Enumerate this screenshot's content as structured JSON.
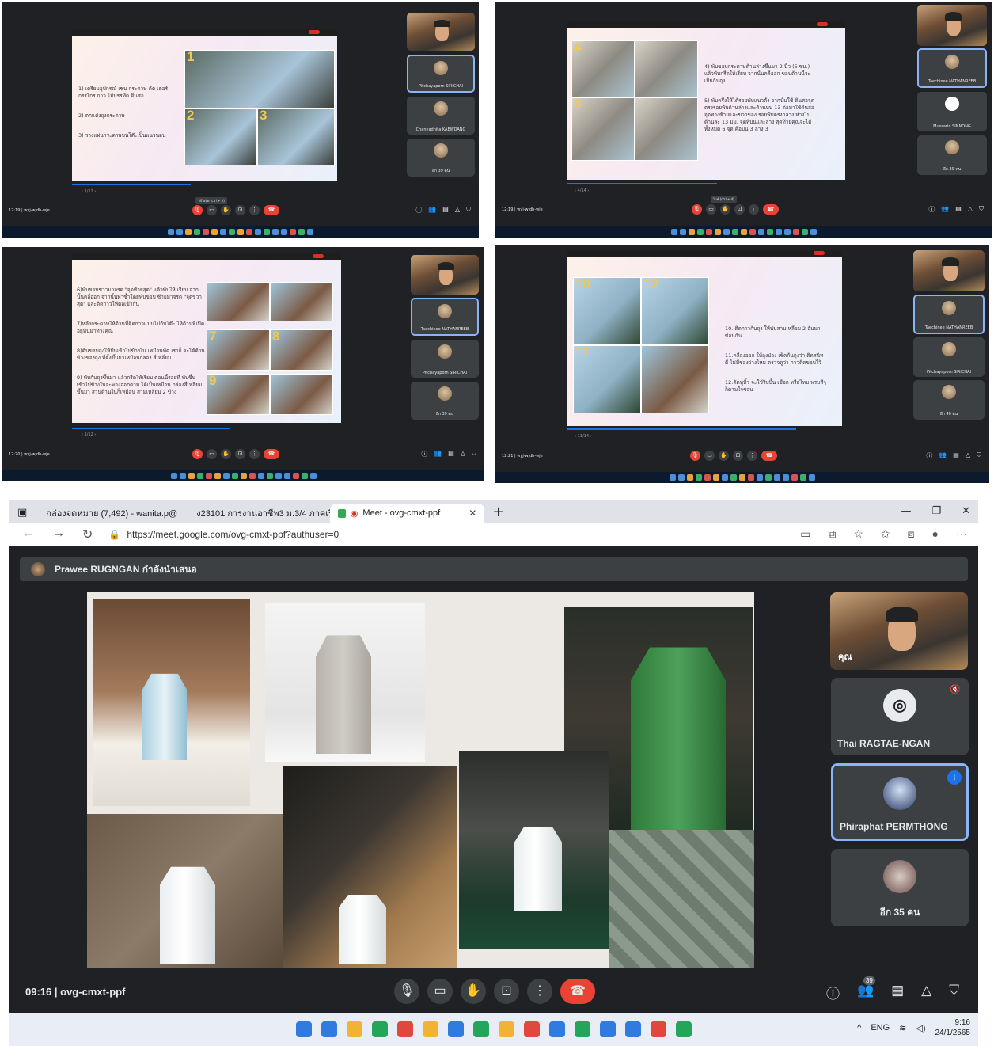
{
  "panel1": {
    "slide_lines": [
      "1) เตรียมอุปกรณ์ เช่น กระดาษ คัด เตอร์ กรรไกร กาว ไม้บรรทัด ดินสอ",
      "2) ตกแต่งถุงกระดาษ",
      "3) วางแผ่นกระดาษบนโต๊ะเป็นแนวนอน"
    ],
    "photo_numbers": [
      "1",
      "2",
      "3"
    ],
    "pager": "‹ 1/12 ›",
    "tooltip": "วิดีโอปิด (ctrl + e)",
    "tiles": [
      "Pitchayaporn SIRICHAI",
      "Chanyadhita KAEWDANG",
      "อีก 39 คน"
    ],
    "self_label": "คุณ",
    "clock": "12:19  |  wyj-wjdh-wje"
  },
  "panel2": {
    "slide_lines": [
      "4) พับขอบกระดาษด้านล่างขึ้นมา 2 นิ้ว (5 ซม.) แล้วพับกรีดให้เรียบ จากนั้นคลี่ออก ขอบด้านนี้จะเป็นก้นถุง",
      "5) พับครึ่งให้ได้รอยพับแนวตั้ง จากนั้นใช้ ดินสอจุดตรงรอยพับด้านล่างและด้านบน 13 ต่อมาใช้ดินสอจุดทางซ้ายและขวาของ รอยพับตรงกลาง ห่างไปด้านละ 13 มม. จุดที่บนและล่าง สุดท้ายคุณจะได้ทั้งหมด 6 จุด คือบน 3 ล่าง 3"
    ],
    "photo_numbers": [
      "4",
      "5"
    ],
    "pager": "‹ 4/14 ›",
    "tooltip": "ไมค์ (ctrl + d)",
    "tiles": [
      "Taechinee NATHANREEB",
      "Mussarin SINNONG",
      "อีก 39 คน"
    ],
    "self_label": "คุณ",
    "clock": "12:19  |  wyj-wjdh-wje"
  },
  "panel3": {
    "slide_lines": [
      "6)พับขอบขวามาจรด \"จุดซ้ายสุด\" แล้วพับให้ เรียบ จากนั้นคลี่ออก จากนั้นทำซ้ำโดยพับขอบ ซ้ายมาจรด \"จุดขวาสุด\" และติดกาวให้ต่อเข้ากัน",
      "7)หลังกระดาษให้ด้านที่ติดกาวแนบไปกับโต๊ะ ให้ด้านที่เปิดอยู่หันมาทางคุณ",
      "8)ดันขอบถุงให้ปันเข้าไปข้างใน เหมือนพัด เราก็ จะได้ด้านข้างของถุง ที่ตั้งขึ้นมาเหมือนกล่อง สี่เหลี่ยม",
      "9) พับก้นถุงขึ้นมา แล้วกรีดให้เรียบ ตอนนี้รอยที่ พับขึ้นเข้าไปข้างในจะพองออกตาม ได้เป็นเหมือน กล่องสี่เหลี่ยมขึ้นมา ส่วนด้านในก็เหมือน สามเหลี่ยม 2 ข้าง"
    ],
    "photo_numbers": [
      "7",
      "8",
      "9"
    ],
    "pager": "‹ 1/12 ›",
    "tiles": [
      "Taechinee NATHANREEB",
      "Pitchayaporn SIRICHAI",
      "อีก 39 คน"
    ],
    "self_label": "คุณ",
    "clock": "12:20  |  wyj-wjdh-wje"
  },
  "panel4": {
    "slide_lines": [
      "10. ติดกาวก้นถุง ให้พับสามเหลี่ยม 2 อันมาซ้อนกัน",
      "11.คลี่ถุงออก ให้ถุงป่อง เช็คก้นถุงว่า ติดสนิทดี ไม่มีช่องว่างไหม ตรวจดูว่า กาวติดขอบไว้",
      "12.ตัดหูหิ้ว จะใช้ริบบิ้น เชือก หรือไหม พรมสีๆ ก็ตามใจชอบ"
    ],
    "photo_numbers": [
      "10",
      "11",
      "12"
    ],
    "pager": "‹ 11/14 ›",
    "tiles": [
      "Taechinee NATHANREEB",
      "Pitchayaporn SIRICHAI",
      "อีก 40 คน"
    ],
    "self_label": "คุณ",
    "clock": "12:21  |  wyj-wjdh-wje"
  },
  "browser": {
    "tabs": [
      {
        "label": "กล่องจดหมาย (7,492) - wanita.p@",
        "icon": "gmail-icon"
      },
      {
        "label": "ง23101 การงานอาชีพ3 ม.3/4 ภาคเรี",
        "icon": "classroom-icon"
      },
      {
        "label": "Meet - ovg-cmxt-ppf",
        "icon": "meet-icon"
      }
    ],
    "new_tab": "+",
    "url": "https://meet.google.com/ovg-cmxt-ppf?authuser=0",
    "presenter": "Prawee RUGNGAN กำลังนำเสนอ",
    "self_label": "คุณ",
    "participants": [
      {
        "name": "Thai RAGTAE-NGAN",
        "muted": true
      },
      {
        "name": "Phiraphat PERMTHONG",
        "speaking": true
      },
      {
        "name": "อีก 35 คน"
      }
    ],
    "time_code": "09:16",
    "meeting_code": "ovg-cmxt-ppf",
    "people_count": "39",
    "tray": {
      "lang": "ENG",
      "time": "9:16",
      "date": "24/1/2565"
    }
  },
  "colors": {
    "meet_bg": "#202124",
    "tile_bg": "#3c4043",
    "hangup": "#ea4335",
    "active_border": "#8ab4f8"
  }
}
